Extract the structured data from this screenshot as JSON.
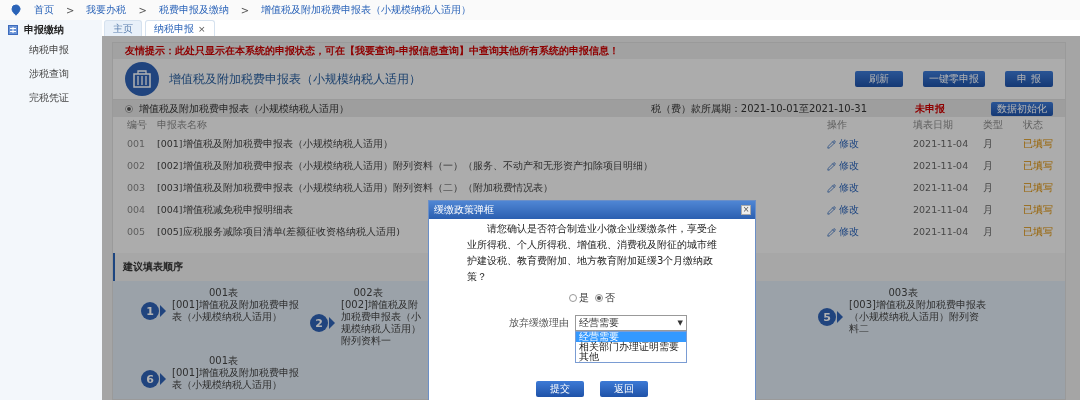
{
  "breadcrumb": {
    "separator": ">",
    "items": [
      "首页",
      "我要办税",
      "税费申报及缴纳",
      "增值税及附加税费申报表（小规模纳税人适用）"
    ]
  },
  "sidebar": {
    "title": "申报缴纳",
    "items": [
      "纳税申报",
      "涉税查询",
      "完税凭证"
    ]
  },
  "tabs": [
    {
      "label": "主页",
      "selected": false
    },
    {
      "label": "纳税申报",
      "selected": true,
      "close": "×"
    }
  ],
  "notice": "友情提示：此处只显示在本系统的申报状态，可在【我要查询-申报信息查询】中查询其他所有系统的申报信息！",
  "form_title": "增值税及附加税费申报表（小规模纳税人适用）",
  "buttons": [
    "刷新",
    "一键零申报",
    "申 报"
  ],
  "section": {
    "label": "增值税及附加税费申报表（小规模纳税人适用）",
    "checked": true,
    "period": "税（费）款所属期：2021-10-01至2021-10-31",
    "status": "未申报",
    "button": "数据初始化"
  },
  "table": {
    "columns": [
      "编号",
      "申报表名称",
      "操作",
      "填表日期",
      "类型",
      "状态"
    ],
    "rows": [
      {
        "number": "001",
        "name": "[001]增值税及附加税费申报表（小规模纳税人适用）",
        "action": "修改",
        "date": "2021-11-04",
        "type": "月",
        "status": "已填写"
      },
      {
        "number": "002",
        "name": "[002]增值税及附加税费申报表（小规模纳税人适用）附列资料（一）（服务、不动产和无形资产扣除项目明细）",
        "action": "修改",
        "date": "2021-11-04",
        "type": "月",
        "status": "已填写"
      },
      {
        "number": "003",
        "name": "[003]增值税及附加税费申报表（小规模纳税人适用）附列资料（二）（附加税费情况表）",
        "action": "修改",
        "date": "2021-11-04",
        "type": "月",
        "status": "已填写"
      },
      {
        "number": "004",
        "name": "[004]增值税减免税申报明细表",
        "action": "修改",
        "date": "2021-11-04",
        "type": "月",
        "status": "已填写"
      },
      {
        "number": "005",
        "name": "[005]应税服务减除项目清单(差额征收资格纳税人适用)",
        "action": "修改",
        "date": "2021-11-04",
        "type": "月",
        "status": "已填写"
      }
    ]
  },
  "steps": {
    "title": "建议填表顺序",
    "rows": [
      [
        {
          "badge": "1",
          "code": "001表",
          "name": "[001]增值税及附加税费申报表（小规模纳税人适用）"
        },
        {
          "badge": "2",
          "code": "002表",
          "name": "[002]增值税及附加税费申报表（小规模纳税人适用）附列资料一"
        },
        {
          "badge": "5",
          "code": "003表",
          "name": "[003]增值税及附加税费申报表（小规模纳税人适用）附列资料二"
        }
      ],
      [
        {
          "badge": "6",
          "code": "001表",
          "name": "[001]增值税及附加税费申报表（小规模纳税人适用）"
        }
      ]
    ]
  },
  "modal": {
    "title": "缓缴政策弹框",
    "close": "×",
    "question": "请您确认是否符合制造业小微企业缓缴条件，享受企业所得税、个人所得税、增值税、消费税及附征的城市维护建设税、教育费附加、地方教育附加延缓3个月缴纳政策？",
    "options": [
      {
        "label": "是",
        "selected": false
      },
      {
        "label": "否",
        "selected": true
      }
    ],
    "reason_label": "放弃缓缴理由",
    "reason_value": "经营需要",
    "arrow": "▼",
    "reason_options": [
      {
        "label": "经营需要",
        "selected": true
      },
      {
        "label": "相关部门办理证明需要",
        "selected": false
      },
      {
        "label": "其他",
        "selected": false
      }
    ],
    "buttons": [
      "提交",
      "返回"
    ]
  }
}
